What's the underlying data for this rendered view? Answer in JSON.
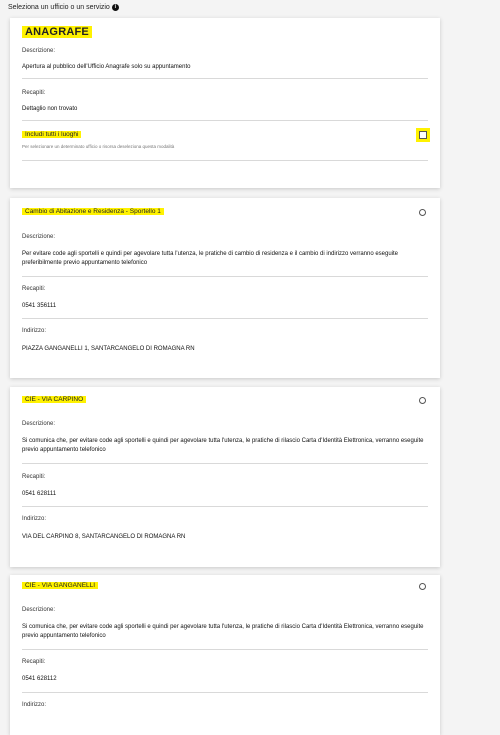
{
  "header": {
    "title": "Seleziona un ufficio o un servizio",
    "info_icon": "info-icon"
  },
  "main_card": {
    "title": "ANAGRAFE",
    "descrizione_label": "Descrizione:",
    "descrizione_value": "Apertura al pubblico dell'Ufficio Anagrafe solo su appuntamento",
    "recapiti_label": "Recapiti:",
    "recapiti_value": "Dettaglio non trovato",
    "checkbox_label": "Includi tutti i luoghi",
    "checkbox_hint": "Per selezionare un determinato ufficio o risorsa deseleziona questa modalità",
    "checkbox_checked": false
  },
  "cards": [
    {
      "title": "Cambio di Abitazione e Residenza - Sportello 1",
      "descrizione_label": "Descrizione:",
      "descrizione_value": "Per evitare code agli sportelli e quindi per agevolare tutta l'utenza, le pratiche di cambio di residenza e il cambio di indirizzo verranno eseguite preferibilmente previo appuntamento telefonico",
      "recapiti_label": "Recapiti:",
      "recapiti_value": "0541 356111",
      "indirizzo_label": "Indirizzo:",
      "indirizzo_value": "PIAZZA GANGANELLI 1, SANTARCANGELO DI ROMAGNA RN"
    },
    {
      "title": "CIE - VIA CARPINO",
      "descrizione_label": "Descrizione:",
      "descrizione_value": "Si comunica che, per evitare code agli sportelli e quindi per agevolare tutta l'utenza, le pratiche di rilascio Carta d'Identità Elettronica, verranno eseguite previo appuntamento telefonico",
      "recapiti_label": "Recapiti:",
      "recapiti_value": "0541 628111",
      "indirizzo_label": "Indirizzo:",
      "indirizzo_value": "VIA DEL CARPINO 8, SANTARCANGELO DI ROMAGNA RN"
    },
    {
      "title": "CIE - VIA GANGANELLI",
      "descrizione_label": "Descrizione:",
      "descrizione_value": "Si comunica che, per evitare code agli sportelli e quindi per agevolare tutta l'utenza, le pratiche di rilascio Carta d'Identità Elettronica, verranno eseguite previo appuntamento telefonico",
      "recapiti_label": "Recapiti:",
      "recapiti_value": "0541 628112",
      "indirizzo_label": "Indirizzo:"
    }
  ],
  "colors": {
    "highlight": "#fff200",
    "card_bg": "#ffffff",
    "page_bg": "#f4f4f4"
  }
}
